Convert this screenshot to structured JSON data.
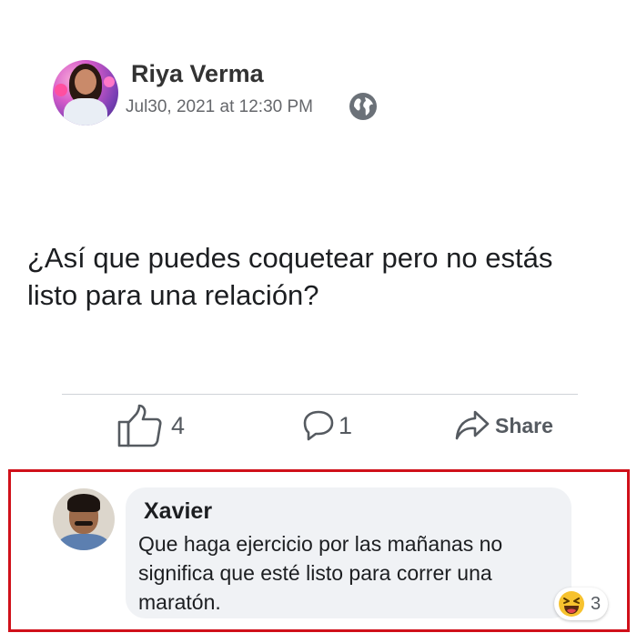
{
  "post": {
    "author": "Riya Verma",
    "timestamp": "Jul30, 2021 at 12:30 PM",
    "privacy_icon": "globe-icon",
    "text": "¿Así que puedes coquetear pero no estás listo para una relación?"
  },
  "actions": {
    "like_count": "4",
    "comment_count": "1",
    "share_label": "Share"
  },
  "comment": {
    "author": "Xavier",
    "text": "Que haga ejercicio por las mañanas no significa que esté listo para correr una maratón.",
    "reaction_icon": "laughing-emoji-icon",
    "reaction_count": "3"
  },
  "colors": {
    "highlight_border": "#d0101a",
    "bubble_bg": "#f0f2f5",
    "icon_gray": "#555a60"
  }
}
